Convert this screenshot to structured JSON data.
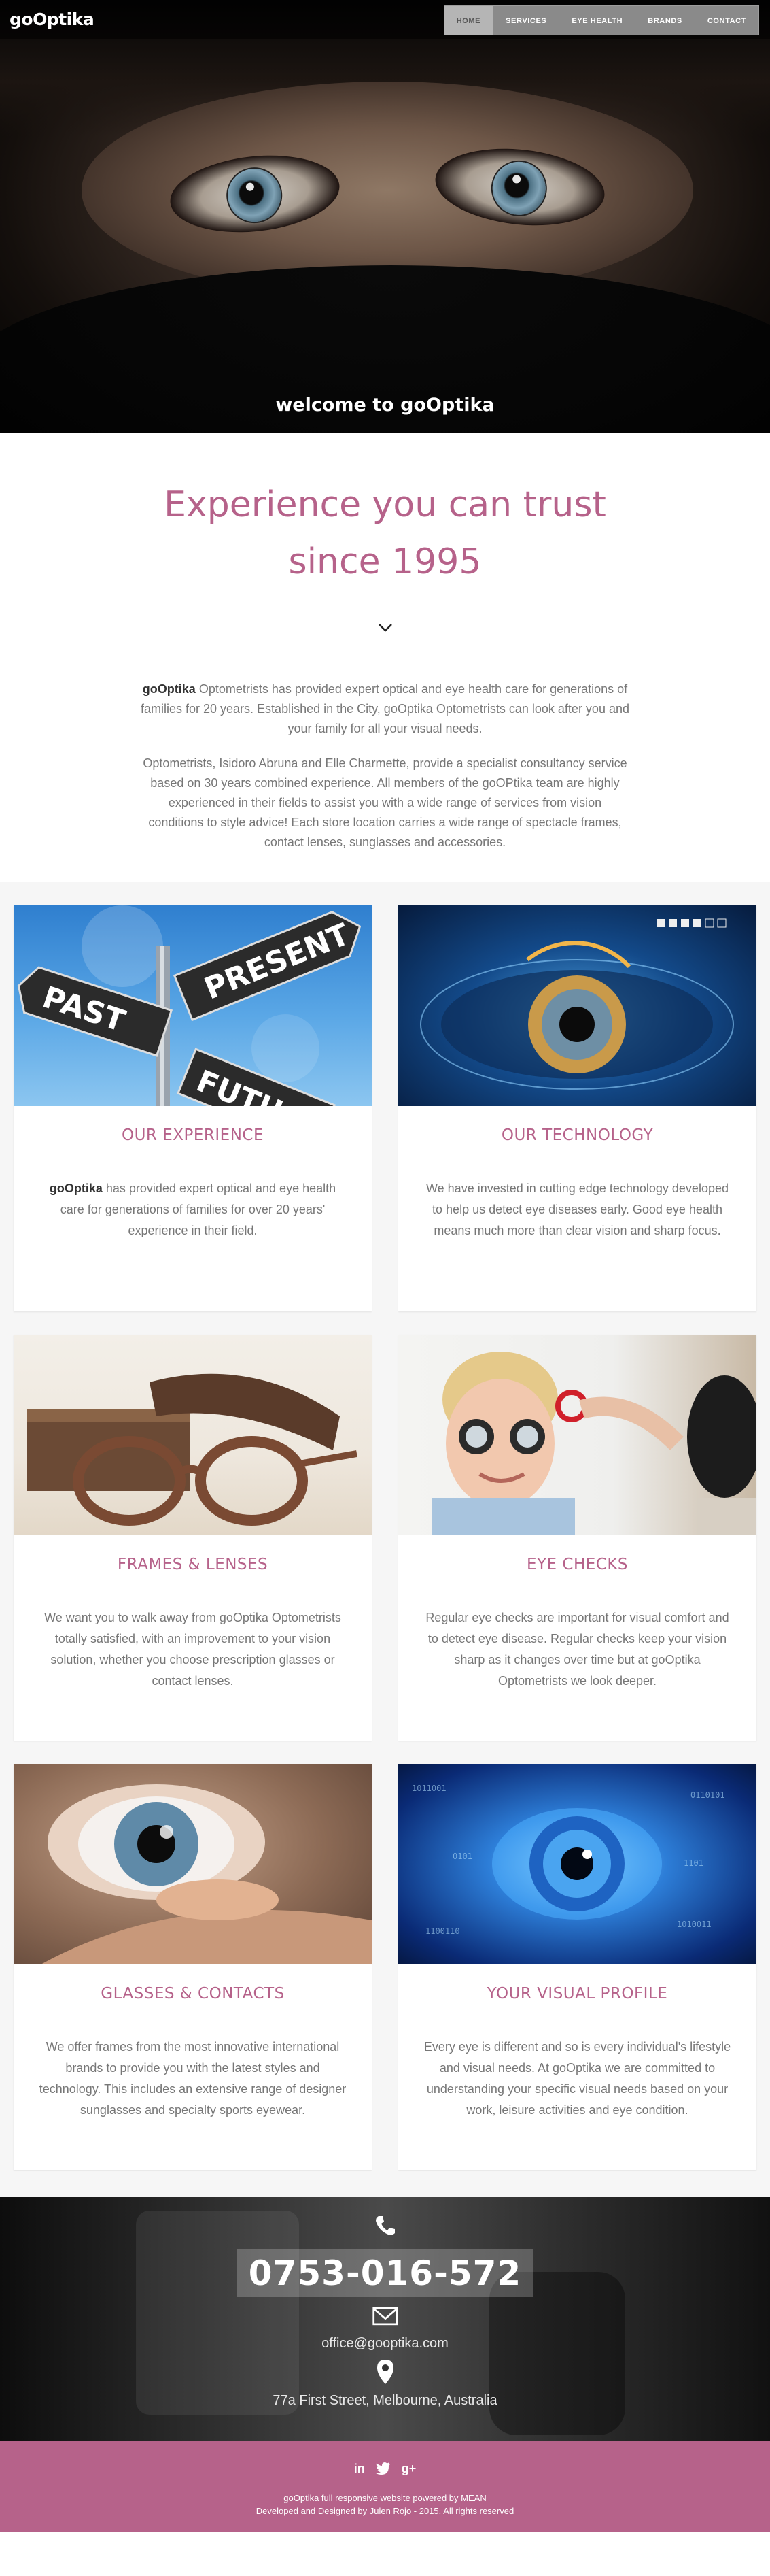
{
  "header": {
    "logo": "goOptika",
    "nav": [
      {
        "label": "HOME",
        "active": true
      },
      {
        "label": "SERVICES"
      },
      {
        "label": "EYE HEALTH"
      },
      {
        "label": "BRANDS"
      },
      {
        "label": "CONTACT"
      }
    ]
  },
  "hero": {
    "caption": "welcome to goOptika"
  },
  "intro": {
    "heading": "Experience you can trust since 1995",
    "p1_brand": "goOptika",
    "p1_text": " Optometrists has provided expert optical and eye health care for generations of families for 20 years. Established in the City, goOptika Optometrists can look after you and your family for all your visual needs.",
    "p2": "Optometrists, Isidoro Abruna and Elle Charmette, provide a specialist consultancy service based on 30 years combined experience. All members of the goOPtika team are highly experienced in their fields to assist you with a wide range of services from vision conditions to style advice! Each store location carries a wide range of spectacle frames, contact lenses, sunglasses and accessories."
  },
  "cards": [
    {
      "title": "OUR EXPERIENCE",
      "brand": "goOptika",
      "text": " has provided expert optical and eye health care for generations of families for over 20 years' experience in their field.",
      "sign_past": "PAST",
      "sign_present": "PRESENT",
      "sign_future": "FUTU"
    },
    {
      "title": "OUR TECHNOLOGY",
      "text": "We have invested in cutting edge technology developed to help us detect eye diseases early. Good eye health means much more than clear vision and sharp focus."
    },
    {
      "title": "FRAMES & LENSES",
      "text": "We want you to walk away from goOptika Optometrists totally satisfied, with an improvement to your vision solution, whether you choose prescription glasses or contact lenses."
    },
    {
      "title": "EYE CHECKS",
      "text": "Regular eye checks are important for visual comfort and to detect eye disease. Regular checks keep your vision sharp as it changes over time but at goOptika Optometrists we look deeper."
    },
    {
      "title": "GLASSES & CONTACTS",
      "text": "We offer frames from the most innovative international brands to provide you with the latest styles and technology. This includes an extensive range of designer sunglasses and specialty sports eyewear."
    },
    {
      "title": "YOUR VISUAL PROFILE",
      "text": "Every eye is different and so is every individual's lifestyle and visual needs. At goOptika we are committed to understanding your specific visual needs based on your work, leisure activities and eye condition."
    }
  ],
  "contact": {
    "phone": "0753-016-572",
    "email": "office@gooptika.com",
    "address": "77a First Street, Melbourne, Australia"
  },
  "footer": {
    "social": [
      "in",
      "twitter-bird",
      "g+"
    ],
    "line1": "goOptika full responsive website powered by MEAN",
    "line2": "Developed and Designed by Julen Rojo - 2015. All rights reserved"
  },
  "colors": {
    "accent": "#b6628a",
    "nav_bg": "#8a8a8a"
  }
}
